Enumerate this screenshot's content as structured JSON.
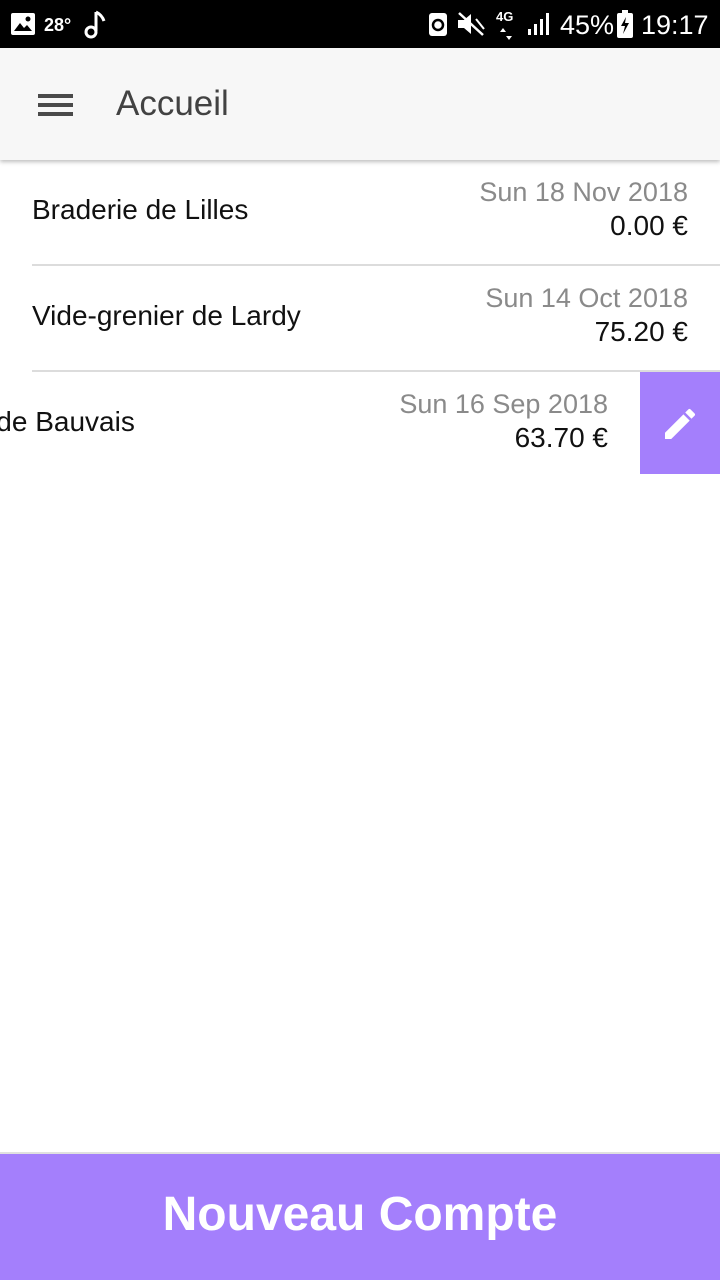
{
  "status_bar": {
    "temperature": "28°",
    "signal_type": "4G",
    "battery_percent": "45%",
    "time": "19:17",
    "icons": [
      "gallery-icon",
      "music-note-icon",
      "recycle-icon",
      "mute-icon",
      "signal-icon",
      "battery-charging-icon"
    ]
  },
  "app_bar": {
    "title": "Accueil",
    "menu_icon": "hamburger-menu-icon"
  },
  "events": [
    {
      "name": "Braderie de Lilles",
      "date": "Sun 18 Nov 2018",
      "total": "0.00 €"
    },
    {
      "name": "Vide-grenier de Lardy",
      "date": "Sun 14 Oct 2018",
      "total": "75.20 €"
    },
    {
      "name": "cante de Bauvais",
      "date": "Sun 16 Sep 2018",
      "total": "63.70 €",
      "swiped": true,
      "action_icon": "edit-pencil-icon"
    }
  ],
  "footer": {
    "new_account_label": "Nouveau Compte"
  },
  "colors": {
    "accent": "#a47ffc",
    "status_bar": "#000000",
    "app_bar": "#f7f7f7",
    "secondary_text": "#8a8a8a"
  }
}
